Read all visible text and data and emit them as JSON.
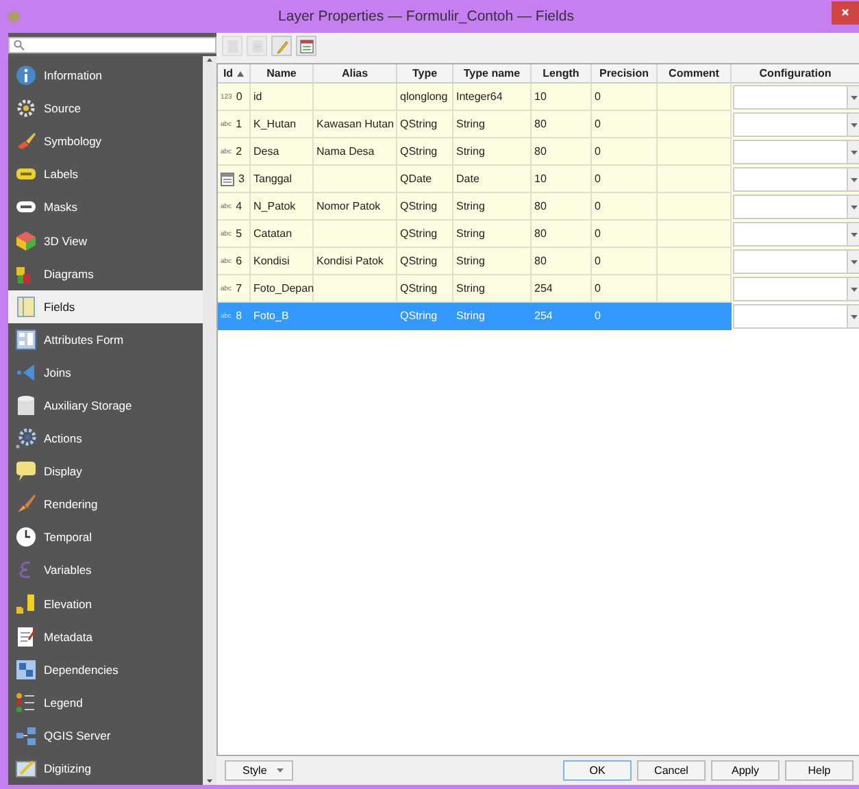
{
  "window": {
    "title": "Layer Properties — Formulir_Contoh — Fields"
  },
  "sidebar": {
    "items": [
      {
        "label": "Information",
        "selected": false
      },
      {
        "label": "Source",
        "selected": false
      },
      {
        "label": "Symbology",
        "selected": false
      },
      {
        "label": "Labels",
        "selected": false
      },
      {
        "label": "Masks",
        "selected": false
      },
      {
        "label": "3D View",
        "selected": false
      },
      {
        "label": "Diagrams",
        "selected": false
      },
      {
        "label": "Fields",
        "selected": true
      },
      {
        "label": "Attributes Form",
        "selected": false
      },
      {
        "label": "Joins",
        "selected": false
      },
      {
        "label": "Auxiliary Storage",
        "selected": false
      },
      {
        "label": "Actions",
        "selected": false
      },
      {
        "label": "Display",
        "selected": false
      },
      {
        "label": "Rendering",
        "selected": false
      },
      {
        "label": "Temporal",
        "selected": false
      },
      {
        "label": "Variables",
        "selected": false
      },
      {
        "label": "Elevation",
        "selected": false
      },
      {
        "label": "Metadata",
        "selected": false
      },
      {
        "label": "Dependencies",
        "selected": false
      },
      {
        "label": "Legend",
        "selected": false
      },
      {
        "label": "QGIS Server",
        "selected": false
      },
      {
        "label": "Digitizing",
        "selected": false
      }
    ]
  },
  "toolbar": [
    {
      "kind": "new",
      "disabled": true
    },
    {
      "kind": "delete",
      "disabled": true
    },
    {
      "kind": "edit",
      "disabled": false
    },
    {
      "kind": "calculator",
      "disabled": false
    }
  ],
  "table": {
    "columns": [
      {
        "label": "Id",
        "sorted": true
      },
      {
        "label": "Name",
        "sorted": false
      },
      {
        "label": "Alias",
        "sorted": false
      },
      {
        "label": "Type",
        "sorted": false
      },
      {
        "label": "Type name",
        "sorted": false
      },
      {
        "label": "Length",
        "sorted": false
      },
      {
        "label": "Precision",
        "sorted": false
      },
      {
        "label": "Comment",
        "sorted": false
      },
      {
        "label": "Configuration",
        "sorted": false
      }
    ],
    "rows": [
      {
        "kind": "integer",
        "badge": "123",
        "id": "0",
        "name": "id",
        "alias": "",
        "type": "qlonglong",
        "type_name": "Integer64",
        "length": "10",
        "precision": "0",
        "comment": "",
        "selected": false
      },
      {
        "kind": "string",
        "badge": "abc",
        "id": "1",
        "name": "K_Hutan",
        "alias": "Kawasan Hutan",
        "type": "QString",
        "type_name": "String",
        "length": "80",
        "precision": "0",
        "comment": "",
        "selected": false
      },
      {
        "kind": "string",
        "badge": "abc",
        "id": "2",
        "name": "Desa",
        "alias": "Nama Desa",
        "type": "QString",
        "type_name": "String",
        "length": "80",
        "precision": "0",
        "comment": "",
        "selected": false
      },
      {
        "kind": "date",
        "id": "3",
        "name": "Tanggal",
        "alias": "",
        "type": "QDate",
        "type_name": "Date",
        "length": "10",
        "precision": "0",
        "comment": "",
        "selected": false
      },
      {
        "kind": "string",
        "badge": "abc",
        "id": "4",
        "name": "N_Patok",
        "alias": "Nomor Patok",
        "type": "QString",
        "type_name": "String",
        "length": "80",
        "precision": "0",
        "comment": "",
        "selected": false
      },
      {
        "kind": "string",
        "badge": "abc",
        "id": "5",
        "name": "Catatan",
        "alias": "",
        "type": "QString",
        "type_name": "String",
        "length": "80",
        "precision": "0",
        "comment": "",
        "selected": false
      },
      {
        "kind": "string",
        "badge": "abc",
        "id": "6",
        "name": "Kondisi",
        "alias": "Kondisi Patok",
        "type": "QString",
        "type_name": "String",
        "length": "80",
        "precision": "0",
        "comment": "",
        "selected": false
      },
      {
        "kind": "string",
        "badge": "abc",
        "id": "7",
        "name": "Foto_Depan",
        "alias": "",
        "type": "QString",
        "type_name": "String",
        "length": "254",
        "precision": "0",
        "comment": "",
        "selected": false
      },
      {
        "kind": "string",
        "badge": "abc",
        "id": "8",
        "name": "Foto_B",
        "alias": "",
        "type": "QString",
        "type_name": "String",
        "length": "254",
        "precision": "0",
        "comment": "",
        "selected": true
      }
    ]
  },
  "footer": {
    "style_button": "Style",
    "buttons": [
      "OK",
      "Cancel",
      "Apply",
      "Help"
    ]
  }
}
